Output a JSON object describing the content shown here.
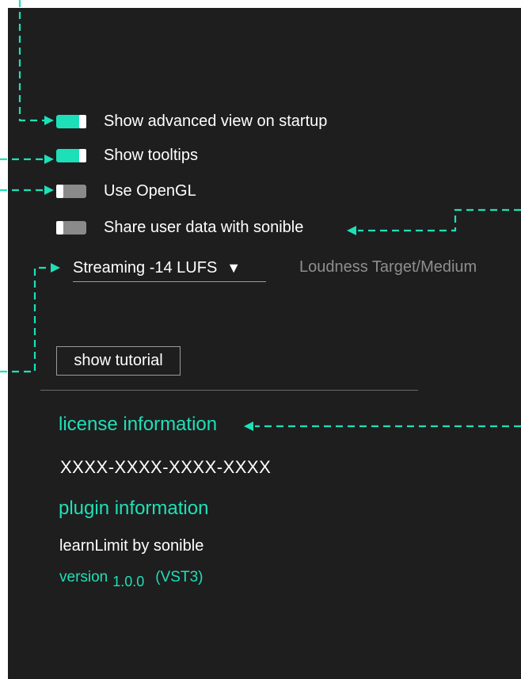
{
  "settings": {
    "toggles": [
      {
        "label": "Show advanced view on startup",
        "state": "on"
      },
      {
        "label": "Show tooltips",
        "state": "on"
      },
      {
        "label": "Use OpenGL",
        "state": "off"
      },
      {
        "label": "Share user data with sonible",
        "state": "off"
      }
    ],
    "loudness": {
      "selected": "Streaming -14 LUFS",
      "arrow": "▼",
      "description": "Loudness Target/Medium"
    },
    "tutorial_button": "show tutorial"
  },
  "license": {
    "title": "license information",
    "key": "XXXX-XXXX-XXXX-XXXX"
  },
  "plugin": {
    "title": "plugin information",
    "name": "learnLimit by sonible",
    "version_label": "version",
    "version_number": "1.0.0",
    "format": "(VST3)"
  },
  "colors": {
    "accent": "#1ee0b8",
    "panel_bg": "#1e1e1e",
    "toggle_off": "#8a8a8a"
  }
}
